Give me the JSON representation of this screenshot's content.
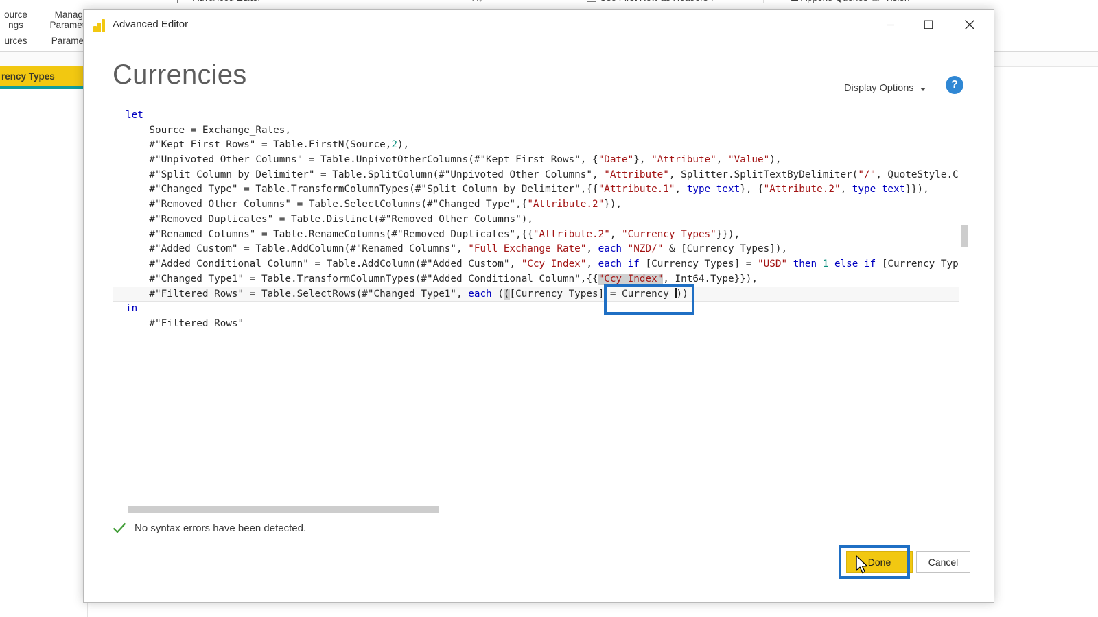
{
  "background": {
    "ribbon_items": [
      {
        "label": "ource\nngs",
        "sub": "urces"
      },
      {
        "label": "Manage\nParameter",
        "sub": "Paramete"
      },
      {
        "label": "Advanced Editor"
      },
      {
        "label": "Use First Row as Headers"
      },
      {
        "label": "Append Queries"
      },
      {
        "label": "Vision"
      }
    ],
    "query_tab": "rency Types",
    "sort_icon": "sort-ascending-icon"
  },
  "window": {
    "title": "Advanced Editor",
    "app_icon": "power-bi-icon",
    "minimize": "minimize-icon",
    "maximize": "maximize-icon",
    "close": "close-icon"
  },
  "header": {
    "query_name": "Currencies",
    "display_options_label": "Display Options",
    "help_label": "?"
  },
  "code": {
    "lines": [
      [
        {
          "t": "let",
          "c": "kw"
        }
      ],
      [
        {
          "t": "    Source = Exchange_Rates,"
        }
      ],
      [
        {
          "t": "    #\"Kept First Rows\" = Table.FirstN(Source,"
        },
        {
          "t": "2",
          "c": "num"
        },
        {
          "t": "),"
        }
      ],
      [
        {
          "t": "    #\"Unpivoted Other Columns\" = Table.UnpivotOtherColumns(#\"Kept First Rows\", {"
        },
        {
          "t": "\"Date\"",
          "c": "str"
        },
        {
          "t": "}, "
        },
        {
          "t": "\"Attribute\"",
          "c": "str"
        },
        {
          "t": ", "
        },
        {
          "t": "\"Value\"",
          "c": "str"
        },
        {
          "t": "),"
        }
      ],
      [
        {
          "t": "    #\"Split Column by Delimiter\" = Table.SplitColumn(#\"Unpivoted Other Columns\", "
        },
        {
          "t": "\"Attribute\"",
          "c": "str"
        },
        {
          "t": ", Splitter.SplitTextByDelimiter("
        },
        {
          "t": "\"/\"",
          "c": "str"
        },
        {
          "t": ", QuoteStyle.C"
        }
      ],
      [
        {
          "t": "    #\"Changed Type\" = Table.TransformColumnTypes(#\"Split Column by Delimiter\",{{"
        },
        {
          "t": "\"Attribute.1\"",
          "c": "str"
        },
        {
          "t": ", "
        },
        {
          "t": "type",
          "c": "kw"
        },
        {
          "t": " "
        },
        {
          "t": "text",
          "c": "kw"
        },
        {
          "t": "}, {"
        },
        {
          "t": "\"Attribute.2\"",
          "c": "str"
        },
        {
          "t": ", "
        },
        {
          "t": "type",
          "c": "kw"
        },
        {
          "t": " "
        },
        {
          "t": "text",
          "c": "kw"
        },
        {
          "t": "}}),"
        }
      ],
      [
        {
          "t": "    #\"Removed Other Columns\" = Table.SelectColumns(#\"Changed Type\",{"
        },
        {
          "t": "\"Attribute.2\"",
          "c": "str"
        },
        {
          "t": "}),"
        }
      ],
      [
        {
          "t": "    #\"Removed Duplicates\" = Table.Distinct(#\"Removed Other Columns\"),"
        }
      ],
      [
        {
          "t": "    #\"Renamed Columns\" = Table.RenameColumns(#\"Removed Duplicates\",{{"
        },
        {
          "t": "\"Attribute.2\"",
          "c": "str"
        },
        {
          "t": ", "
        },
        {
          "t": "\"Currency Types\"",
          "c": "str"
        },
        {
          "t": "}}),"
        }
      ],
      [
        {
          "t": "    #\"Added Custom\" = Table.AddColumn(#\"Renamed Columns\", "
        },
        {
          "t": "\"Full Exchange Rate\"",
          "c": "str"
        },
        {
          "t": ", "
        },
        {
          "t": "each",
          "c": "kw"
        },
        {
          "t": " "
        },
        {
          "t": "\"NZD/\"",
          "c": "str"
        },
        {
          "t": " & [Currency Types]),"
        }
      ],
      [
        {
          "t": "    #\"Added Conditional Column\" = Table.AddColumn(#\"Added Custom\", "
        },
        {
          "t": "\"Ccy Index\"",
          "c": "str"
        },
        {
          "t": ", "
        },
        {
          "t": "each",
          "c": "kw"
        },
        {
          "t": " "
        },
        {
          "t": "if",
          "c": "kw"
        },
        {
          "t": " [Currency Types] = "
        },
        {
          "t": "\"USD\"",
          "c": "str"
        },
        {
          "t": " "
        },
        {
          "t": "then",
          "c": "kw"
        },
        {
          "t": " "
        },
        {
          "t": "1",
          "c": "num"
        },
        {
          "t": " "
        },
        {
          "t": "else",
          "c": "kw"
        },
        {
          "t": " "
        },
        {
          "t": "if",
          "c": "kw"
        },
        {
          "t": " [Currency Typ"
        }
      ],
      [
        {
          "t": "    #\"Changed Type1\" = Table.TransformColumnTypes(#\"Added Conditional Column\",{{"
        },
        {
          "t": "\"Ccy Index\"",
          "c": "str sel"
        },
        {
          "t": ", Int64.Type}}),"
        }
      ],
      [
        {
          "t": "    #\"Filtered Rows\" = Table.SelectRows(#\"Changed Type1\", "
        },
        {
          "t": "each",
          "c": "kw"
        },
        {
          "t": " ("
        },
        {
          "t": "(",
          "c": "sel"
        },
        {
          "t": "[Currency Types] = Currency "
        },
        {
          "t": "CARET"
        },
        {
          "t": "))"
        }
      ],
      [
        {
          "t": "in",
          "c": "kw"
        }
      ],
      [
        {
          "t": "    #\"Filtered Rows\""
        }
      ]
    ],
    "current_line_index": 12
  },
  "status": {
    "icon": "check-icon",
    "message": "No syntax errors have been detected."
  },
  "footer": {
    "done_label": "Done",
    "cancel_label": "Cancel"
  },
  "annotations": {
    "code_highlight": "blue-rectangle-around-filter-expression",
    "done_highlight": "blue-rectangle-around-done-button"
  },
  "colors": {
    "accent_yellow": "#f2c811",
    "annotation_blue": "#1f6fc4",
    "help_blue": "#2f87d4",
    "string_red": "#a31515",
    "keyword_blue": "#0000c0",
    "number_teal": "#0b8f7d",
    "success_green": "#3f9c35"
  }
}
